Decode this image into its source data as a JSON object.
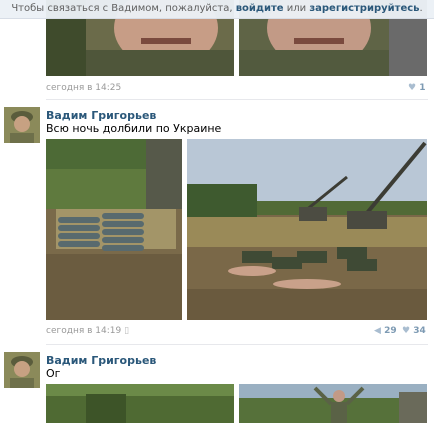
{
  "banner": {
    "prefix": "Чтобы связаться с Вадимом, пожалуйста,",
    "login": "войдите",
    "or": "или",
    "register": "зарегистрируйтесь",
    "suffix": "."
  },
  "posts": [
    {
      "time": "сегодня в 14:25",
      "likes": "1"
    },
    {
      "author": "Вадим Григорьев",
      "text": "Всю ночь долбили по Украине",
      "time": "сегодня в 14:19",
      "reposts": "29",
      "likes": "34"
    },
    {
      "author": "Вадим Григорьев",
      "text": "Ог"
    }
  ],
  "colors": {
    "link": "#2b587a",
    "meta": "#999999",
    "stat": "#7d9ab3"
  }
}
